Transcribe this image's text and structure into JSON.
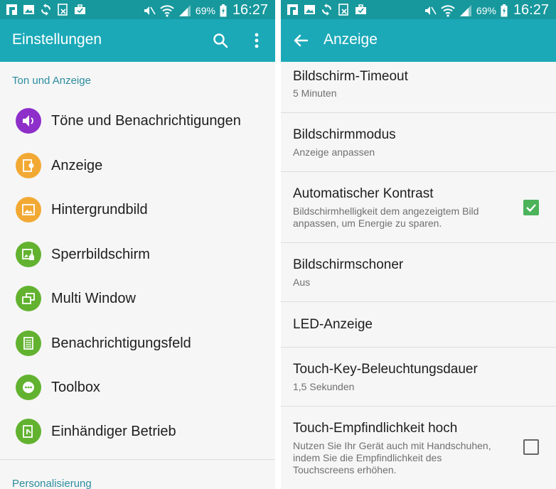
{
  "status_bar": {
    "left_icons": [
      "flipboard-icon",
      "image-icon",
      "sync-icon",
      "blocked-note-icon",
      "briefcase-icon"
    ],
    "battery_percent": "69%",
    "time": "16:27",
    "bar_color": "#17989d"
  },
  "left_screen": {
    "title": "Einstellungen",
    "appbar_color": "#1ba9b8",
    "section_header": "Ton und Anzeige",
    "items": [
      {
        "label": "Töne und Benachrichtigungen",
        "icon": "speaker-icon",
        "color": "#8e2fc9"
      },
      {
        "label": "Anzeige",
        "icon": "display-icon",
        "color": "#f2a934"
      },
      {
        "label": "Hintergrundbild",
        "icon": "wallpaper-icon",
        "color": "#f2a934"
      },
      {
        "label": "Sperrbildschirm",
        "icon": "lockscreen-icon",
        "color": "#62b230"
      },
      {
        "label": "Multi Window",
        "icon": "multi-window-icon",
        "color": "#62b230"
      },
      {
        "label": "Benachrichtigungsfeld",
        "icon": "notification-panel-icon",
        "color": "#62b230"
      },
      {
        "label": "Toolbox",
        "icon": "toolbox-icon",
        "color": "#62b230"
      },
      {
        "label": "Einhändiger Betrieb",
        "icon": "one-hand-icon",
        "color": "#62b230"
      }
    ],
    "next_section_header": "Personalisierung"
  },
  "right_screen": {
    "title": "Anzeige",
    "settings": [
      {
        "title": "Bildschirm-Timeout",
        "subtitle": "5 Minuten"
      },
      {
        "title": "Bildschirmmodus",
        "subtitle": "Anzeige anpassen"
      },
      {
        "title": "Automatischer Kontrast",
        "subtitle_line1": "Bildschirmhelligkeit dem angezeigtem Bild",
        "subtitle_line2": "anpassen, um Energie zu sparen.",
        "checked": true
      },
      {
        "title": "Bildschirmschoner",
        "subtitle": "Aus"
      },
      {
        "title": "LED-Anzeige"
      },
      {
        "title": "Touch-Key-Beleuchtungsdauer",
        "subtitle": "1,5 Sekunden"
      },
      {
        "title": "Touch-Empfindlichkeit hoch",
        "subtitle_line1": "Nutzen Sie Ihr Gerät auch mit Handschuhen,",
        "subtitle_line2": "indem Sie die Empfindlichkeit des",
        "subtitle_line3": "Touchscreens erhöhen.",
        "checked": false
      }
    ],
    "checkbox_color": "#4bb35a"
  }
}
